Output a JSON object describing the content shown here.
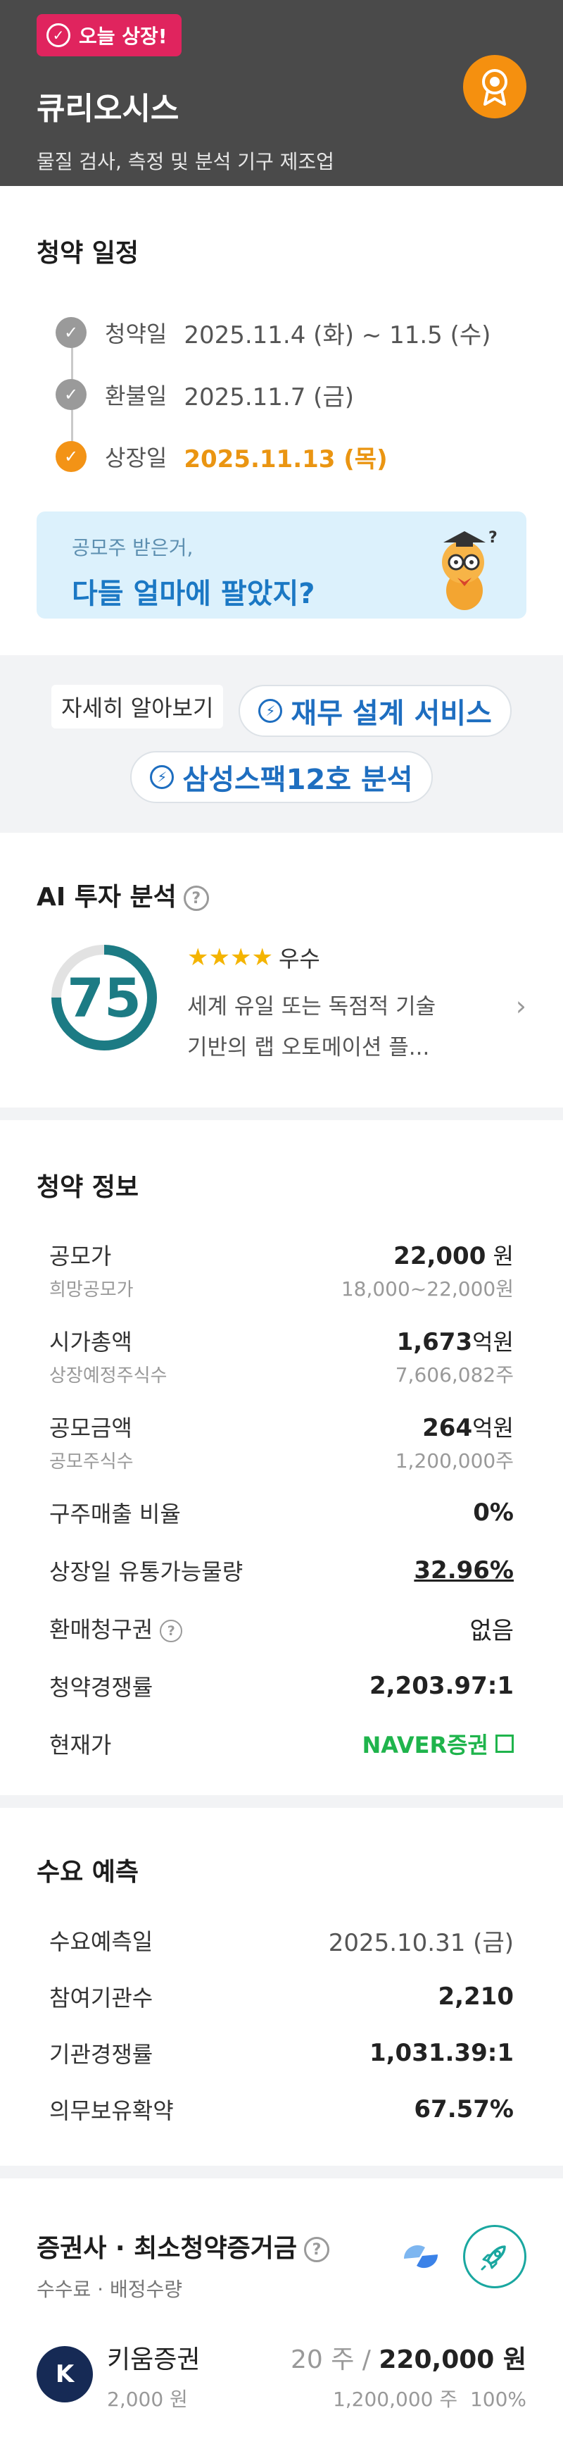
{
  "header": {
    "badge": "오늘 상장!",
    "company": "큐리오시스",
    "description": "물질 검사, 측정 및 분석 기구 제조업"
  },
  "schedule": {
    "title": "청약 일정",
    "items": [
      {
        "label": "청약일",
        "date": "2025.11.4 (화) ~ 11.5 (수)"
      },
      {
        "label": "환불일",
        "date": "2025.11.7 (금)"
      },
      {
        "label": "상장일",
        "date": "2025.11.13 (목)"
      }
    ]
  },
  "promo": {
    "small": "공모주 받은거,",
    "big": "다들 얼마에 팔았지?"
  },
  "actions": {
    "details": "자세히 알아보기",
    "finance": "재무 설계 서비스",
    "analysis": "삼성스팩12호 분석"
  },
  "ai": {
    "title": "AI 투자 분석",
    "score": "75",
    "score_fraction": 0.75,
    "stars": 4,
    "rating": "우수",
    "desc1": "세계 유일 또는 독점적 기술",
    "desc2": "기반의 랩 오토메이션 플..."
  },
  "info": {
    "title": "청약 정보",
    "offer_price_k": "공모가",
    "offer_price_v": "22,000",
    "offer_price_u": " 원",
    "desired_k": "희망공모가",
    "desired_v": "18,000~22,000원",
    "mcap_k": "시가총액",
    "mcap_v": "1,673",
    "mcap_u": "억원",
    "listed_shares_k": "상장예정주식수",
    "listed_shares_v": "7,606,082주",
    "amount_k": "공모금액",
    "amount_v": "264",
    "amount_u": "억원",
    "offer_shares_k": "공모주식수",
    "offer_shares_v": "1,200,000주",
    "old_ratio_k": "구주매출 비율",
    "old_ratio_v": "0%",
    "float_k": "상장일 유통가능물량",
    "float_v": "32.96%",
    "putback_k": "환매청구권",
    "putback_v": "없음",
    "competition_k": "청약경쟁률",
    "competition_v": "2,203.97:1",
    "current_k": "현재가",
    "current_v": "NAVER증권"
  },
  "demand": {
    "title": "수요 예측",
    "date_k": "수요예측일",
    "date_v": "2025.10.31 (금)",
    "inst_k": "참여기관수",
    "inst_v": "2,210",
    "comp_k": "기관경쟁률",
    "comp_v": "1,031.39:1",
    "lockup_k": "의무보유확약",
    "lockup_v": "67.57%"
  },
  "brokers": {
    "title": "증권사 · 최소청약증거금",
    "subtitle": "수수료 · 배정수량",
    "items": [
      {
        "name": "키움증권",
        "fee": "2,000 원",
        "shares": "20 주",
        "deposit": "220,000 원",
        "alloc": "1,200,000 주",
        "pct": "100%"
      }
    ]
  },
  "colors": {
    "accent": "#f39316",
    "badge": "#e0245e",
    "link": "#1e6ec0",
    "score": "#1c7b84",
    "naver": "#1fb44c"
  }
}
